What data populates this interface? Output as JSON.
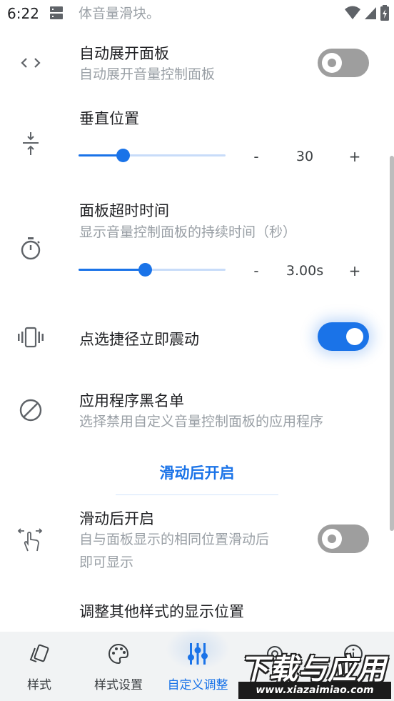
{
  "status_bar": {
    "time": "6:22",
    "cutoff_text": "体音量滑块。"
  },
  "settings": {
    "auto_expand": {
      "title": "自动展开面板",
      "subtitle": "自动展开音量控制面板",
      "enabled": false
    },
    "vertical_position": {
      "title": "垂直位置",
      "value": "30",
      "fraction": 0.3,
      "minus": "-",
      "plus": "+"
    },
    "panel_timeout": {
      "title": "面板超时时间",
      "subtitle": "显示音量控制面板的持续时间（秒）",
      "value": "3.00s",
      "fraction": 0.45,
      "minus": "-",
      "plus": "+"
    },
    "vibrate_shortcut": {
      "title": "点选捷径立即震动",
      "enabled": true
    },
    "app_blacklist": {
      "title": "应用程序黑名单",
      "subtitle": "选择禁用自定义音量控制面板的应用程序"
    }
  },
  "section": {
    "header": "滑动后开启"
  },
  "swipe_open": {
    "title": "滑动后开启",
    "subtitle_line1": "自与面板显示的相同位置滑动后",
    "subtitle_line2": "即可显示",
    "enabled": false
  },
  "adjust_other": {
    "title": "调整其他样式的显示位置"
  },
  "bottom_nav": {
    "items": [
      {
        "label": "样式",
        "icon": "cards-icon",
        "active": false
      },
      {
        "label": "样式设置",
        "icon": "palette-icon",
        "active": false
      },
      {
        "label": "自定义调整",
        "icon": "sliders-icon",
        "active": true
      },
      {
        "label": "",
        "icon": "settings-icon",
        "active": false
      },
      {
        "label": "",
        "icon": "info-icon",
        "active": false
      }
    ]
  },
  "watermark": {
    "main": "下载与应用",
    "sub": "www.xiazaimiao.com"
  },
  "colors": {
    "accent": "#1a73e8",
    "toggle_off": "#9e9e9e",
    "secondary_text": "#9aa0a6"
  }
}
